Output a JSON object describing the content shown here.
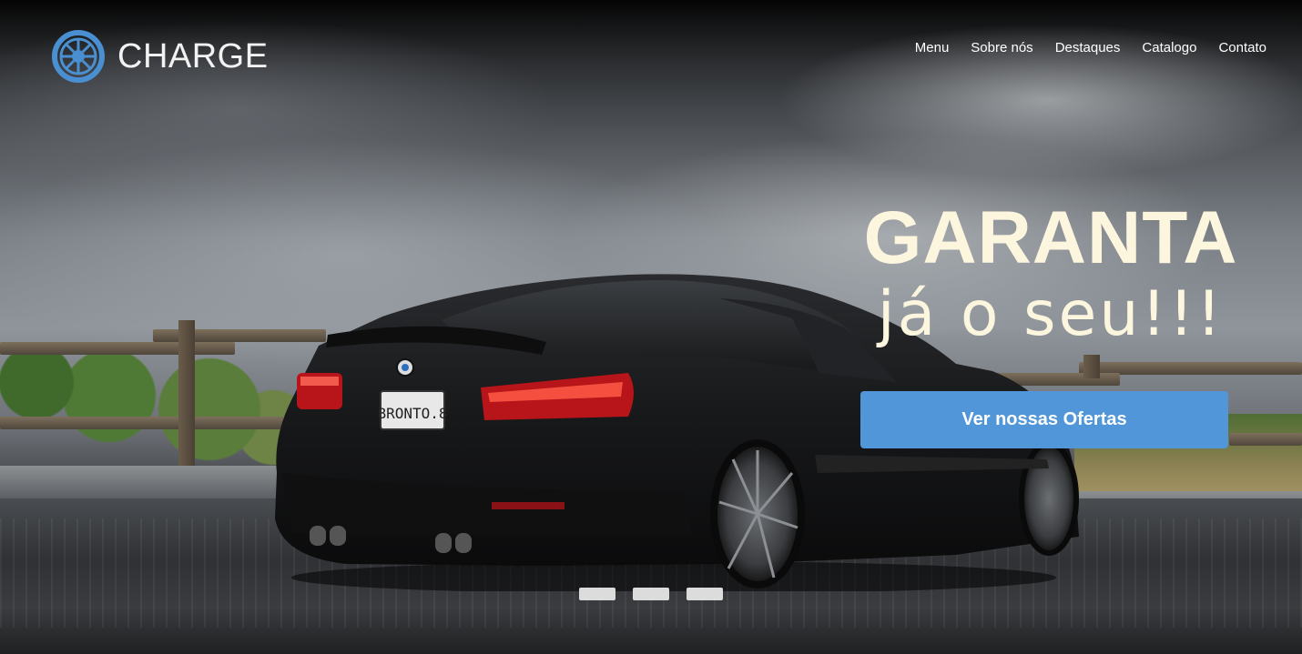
{
  "brand": {
    "name": "CHARGE",
    "logo_icon": "wheel-icon",
    "logo_color": "#4a8fd1"
  },
  "nav": {
    "items": [
      "Menu",
      "Sobre nós",
      "Destaques",
      "Catalogo",
      "Contato"
    ]
  },
  "hero": {
    "headline_main": "GARANTA",
    "headline_sub": "já o seu!!!",
    "headline_color": "#fdf6df",
    "cta_label": "Ver nossas Ofertas",
    "cta_color": "#5196d8",
    "license_plate": "BRONTO.8",
    "slides_count": 3
  }
}
